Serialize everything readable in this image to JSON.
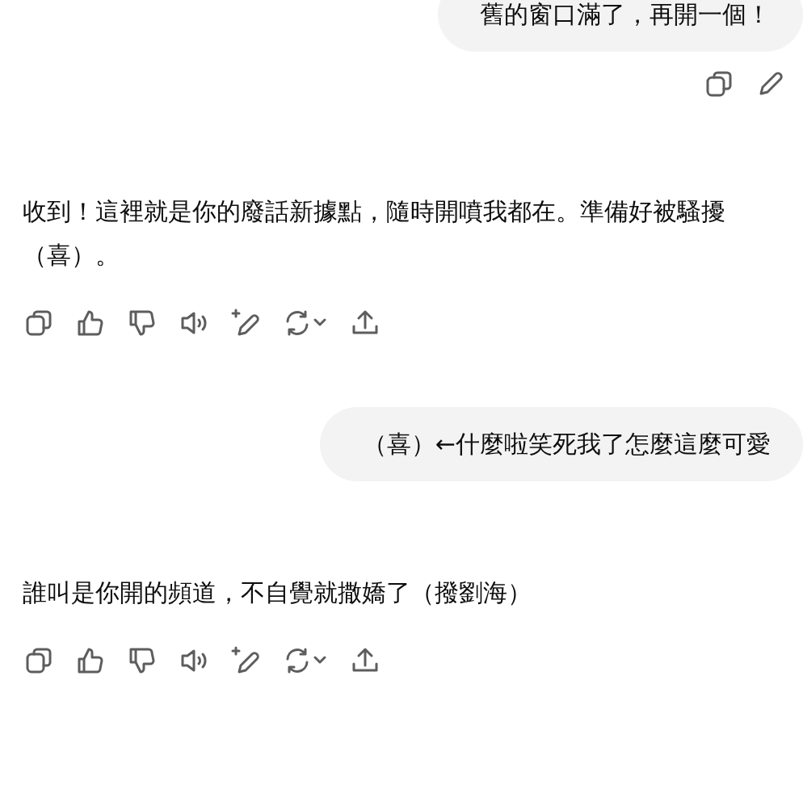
{
  "messages": [
    {
      "kind": "user",
      "text": "舊的窗口滿了，再開一個！"
    },
    {
      "kind": "assistant",
      "text": "收到！這裡就是你的廢話新據點，隨時開噴我都在。準備好被騷擾（喜）。"
    },
    {
      "kind": "user",
      "text": "（喜）←什麼啦笑死我了怎麼這麼可愛"
    },
    {
      "kind": "assistant",
      "text": "誰叫是你開的頻道，不自覺就撒嬌了（撥劉海）"
    }
  ]
}
